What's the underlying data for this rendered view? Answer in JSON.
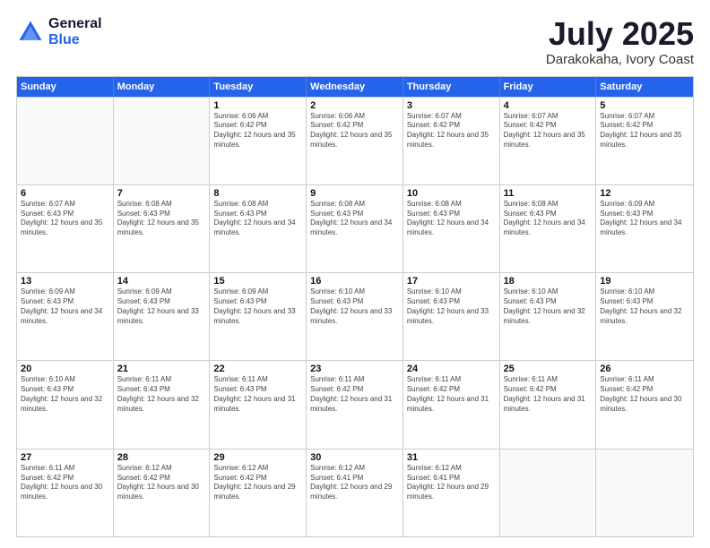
{
  "header": {
    "logo_general": "General",
    "logo_blue": "Blue",
    "month_title": "July 2025",
    "location": "Darakokaha, Ivory Coast"
  },
  "days_of_week": [
    "Sunday",
    "Monday",
    "Tuesday",
    "Wednesday",
    "Thursday",
    "Friday",
    "Saturday"
  ],
  "weeks": [
    [
      {
        "day": "",
        "empty": true
      },
      {
        "day": "",
        "empty": true
      },
      {
        "day": "1",
        "sunrise": "Sunrise: 6:06 AM",
        "sunset": "Sunset: 6:42 PM",
        "daylight": "Daylight: 12 hours and 35 minutes."
      },
      {
        "day": "2",
        "sunrise": "Sunrise: 6:06 AM",
        "sunset": "Sunset: 6:42 PM",
        "daylight": "Daylight: 12 hours and 35 minutes."
      },
      {
        "day": "3",
        "sunrise": "Sunrise: 6:07 AM",
        "sunset": "Sunset: 6:42 PM",
        "daylight": "Daylight: 12 hours and 35 minutes."
      },
      {
        "day": "4",
        "sunrise": "Sunrise: 6:07 AM",
        "sunset": "Sunset: 6:42 PM",
        "daylight": "Daylight: 12 hours and 35 minutes."
      },
      {
        "day": "5",
        "sunrise": "Sunrise: 6:07 AM",
        "sunset": "Sunset: 6:42 PM",
        "daylight": "Daylight: 12 hours and 35 minutes."
      }
    ],
    [
      {
        "day": "6",
        "sunrise": "Sunrise: 6:07 AM",
        "sunset": "Sunset: 6:43 PM",
        "daylight": "Daylight: 12 hours and 35 minutes."
      },
      {
        "day": "7",
        "sunrise": "Sunrise: 6:08 AM",
        "sunset": "Sunset: 6:43 PM",
        "daylight": "Daylight: 12 hours and 35 minutes."
      },
      {
        "day": "8",
        "sunrise": "Sunrise: 6:08 AM",
        "sunset": "Sunset: 6:43 PM",
        "daylight": "Daylight: 12 hours and 34 minutes."
      },
      {
        "day": "9",
        "sunrise": "Sunrise: 6:08 AM",
        "sunset": "Sunset: 6:43 PM",
        "daylight": "Daylight: 12 hours and 34 minutes."
      },
      {
        "day": "10",
        "sunrise": "Sunrise: 6:08 AM",
        "sunset": "Sunset: 6:43 PM",
        "daylight": "Daylight: 12 hours and 34 minutes."
      },
      {
        "day": "11",
        "sunrise": "Sunrise: 6:08 AM",
        "sunset": "Sunset: 6:43 PM",
        "daylight": "Daylight: 12 hours and 34 minutes."
      },
      {
        "day": "12",
        "sunrise": "Sunrise: 6:09 AM",
        "sunset": "Sunset: 6:43 PM",
        "daylight": "Daylight: 12 hours and 34 minutes."
      }
    ],
    [
      {
        "day": "13",
        "sunrise": "Sunrise: 6:09 AM",
        "sunset": "Sunset: 6:43 PM",
        "daylight": "Daylight: 12 hours and 34 minutes."
      },
      {
        "day": "14",
        "sunrise": "Sunrise: 6:09 AM",
        "sunset": "Sunset: 6:43 PM",
        "daylight": "Daylight: 12 hours and 33 minutes."
      },
      {
        "day": "15",
        "sunrise": "Sunrise: 6:09 AM",
        "sunset": "Sunset: 6:43 PM",
        "daylight": "Daylight: 12 hours and 33 minutes."
      },
      {
        "day": "16",
        "sunrise": "Sunrise: 6:10 AM",
        "sunset": "Sunset: 6:43 PM",
        "daylight": "Daylight: 12 hours and 33 minutes."
      },
      {
        "day": "17",
        "sunrise": "Sunrise: 6:10 AM",
        "sunset": "Sunset: 6:43 PM",
        "daylight": "Daylight: 12 hours and 33 minutes."
      },
      {
        "day": "18",
        "sunrise": "Sunrise: 6:10 AM",
        "sunset": "Sunset: 6:43 PM",
        "daylight": "Daylight: 12 hours and 32 minutes."
      },
      {
        "day": "19",
        "sunrise": "Sunrise: 6:10 AM",
        "sunset": "Sunset: 6:43 PM",
        "daylight": "Daylight: 12 hours and 32 minutes."
      }
    ],
    [
      {
        "day": "20",
        "sunrise": "Sunrise: 6:10 AM",
        "sunset": "Sunset: 6:43 PM",
        "daylight": "Daylight: 12 hours and 32 minutes."
      },
      {
        "day": "21",
        "sunrise": "Sunrise: 6:11 AM",
        "sunset": "Sunset: 6:43 PM",
        "daylight": "Daylight: 12 hours and 32 minutes."
      },
      {
        "day": "22",
        "sunrise": "Sunrise: 6:11 AM",
        "sunset": "Sunset: 6:43 PM",
        "daylight": "Daylight: 12 hours and 31 minutes."
      },
      {
        "day": "23",
        "sunrise": "Sunrise: 6:11 AM",
        "sunset": "Sunset: 6:42 PM",
        "daylight": "Daylight: 12 hours and 31 minutes."
      },
      {
        "day": "24",
        "sunrise": "Sunrise: 6:11 AM",
        "sunset": "Sunset: 6:42 PM",
        "daylight": "Daylight: 12 hours and 31 minutes."
      },
      {
        "day": "25",
        "sunrise": "Sunrise: 6:11 AM",
        "sunset": "Sunset: 6:42 PM",
        "daylight": "Daylight: 12 hours and 31 minutes."
      },
      {
        "day": "26",
        "sunrise": "Sunrise: 6:11 AM",
        "sunset": "Sunset: 6:42 PM",
        "daylight": "Daylight: 12 hours and 30 minutes."
      }
    ],
    [
      {
        "day": "27",
        "sunrise": "Sunrise: 6:11 AM",
        "sunset": "Sunset: 6:42 PM",
        "daylight": "Daylight: 12 hours and 30 minutes."
      },
      {
        "day": "28",
        "sunrise": "Sunrise: 6:12 AM",
        "sunset": "Sunset: 6:42 PM",
        "daylight": "Daylight: 12 hours and 30 minutes."
      },
      {
        "day": "29",
        "sunrise": "Sunrise: 6:12 AM",
        "sunset": "Sunset: 6:42 PM",
        "daylight": "Daylight: 12 hours and 29 minutes."
      },
      {
        "day": "30",
        "sunrise": "Sunrise: 6:12 AM",
        "sunset": "Sunset: 6:41 PM",
        "daylight": "Daylight: 12 hours and 29 minutes."
      },
      {
        "day": "31",
        "sunrise": "Sunrise: 6:12 AM",
        "sunset": "Sunset: 6:41 PM",
        "daylight": "Daylight: 12 hours and 29 minutes."
      },
      {
        "day": "",
        "empty": true
      },
      {
        "day": "",
        "empty": true
      }
    ]
  ]
}
